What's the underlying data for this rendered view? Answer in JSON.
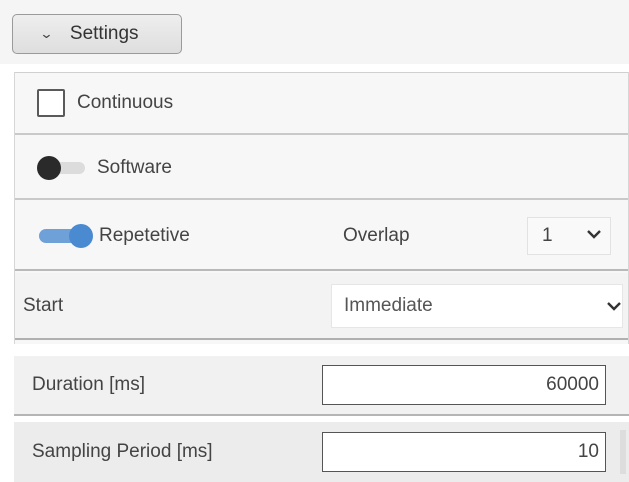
{
  "settings": {
    "label": "Settings"
  },
  "continuous": {
    "label": "Continuous",
    "checked": false
  },
  "software": {
    "label": "Software",
    "enabled": false
  },
  "repetitive": {
    "label": "Repetetive",
    "enabled": true,
    "overlap_label": "Overlap",
    "overlap_value": "1"
  },
  "start": {
    "label": "Start",
    "value": "Immediate"
  },
  "duration": {
    "label": "Duration [ms]",
    "value": "60000"
  },
  "sampling": {
    "label": "Sampling Period [ms]",
    "value": "10"
  },
  "colors": {
    "toggle_on": "#4a8ad0",
    "toggle_off_knob": "#2a2a2a"
  }
}
